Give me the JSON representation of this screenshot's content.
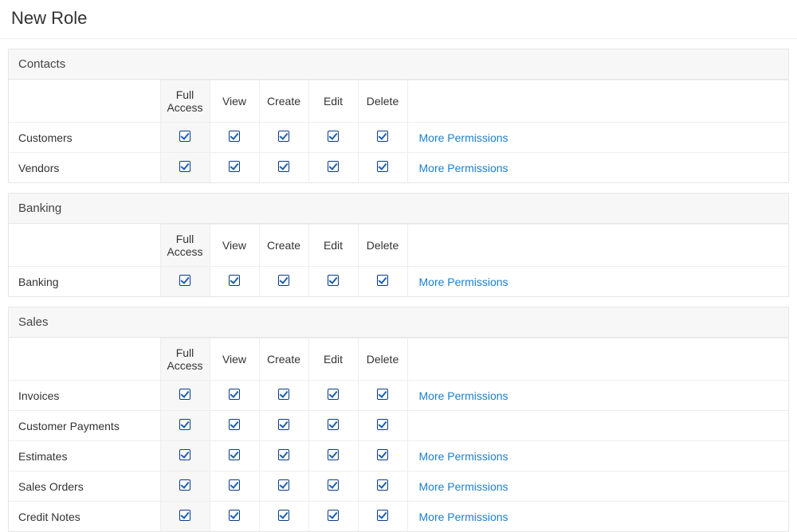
{
  "page_title": "New Role",
  "columns": {
    "full_access": "Full Access",
    "view": "View",
    "create": "Create",
    "edit": "Edit",
    "delete": "Delete"
  },
  "more_permissions_label": "More Permissions",
  "sections": [
    {
      "title": "Contacts",
      "rows": [
        {
          "label": "Customers",
          "full_access": true,
          "view": true,
          "create": true,
          "edit": true,
          "delete": true,
          "more_permissions": true
        },
        {
          "label": "Vendors",
          "full_access": true,
          "view": true,
          "create": true,
          "edit": true,
          "delete": true,
          "more_permissions": true
        }
      ]
    },
    {
      "title": "Banking",
      "rows": [
        {
          "label": "Banking",
          "full_access": true,
          "view": true,
          "create": true,
          "edit": true,
          "delete": true,
          "more_permissions": true
        }
      ]
    },
    {
      "title": "Sales",
      "rows": [
        {
          "label": "Invoices",
          "full_access": true,
          "view": true,
          "create": true,
          "edit": true,
          "delete": true,
          "more_permissions": true
        },
        {
          "label": "Customer Payments",
          "full_access": true,
          "view": true,
          "create": true,
          "edit": true,
          "delete": true,
          "more_permissions": false
        },
        {
          "label": "Estimates",
          "full_access": true,
          "view": true,
          "create": true,
          "edit": true,
          "delete": true,
          "more_permissions": true
        },
        {
          "label": "Sales Orders",
          "full_access": true,
          "view": true,
          "create": true,
          "edit": true,
          "delete": true,
          "more_permissions": true
        },
        {
          "label": "Credit Notes",
          "full_access": true,
          "view": true,
          "create": true,
          "edit": true,
          "delete": true,
          "more_permissions": true
        }
      ]
    }
  ]
}
